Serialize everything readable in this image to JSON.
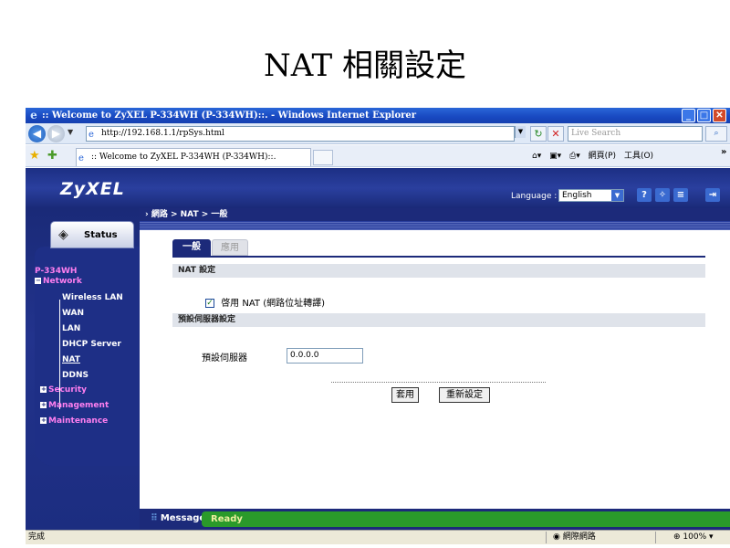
{
  "slide": {
    "title": "NAT 相關設定"
  },
  "window": {
    "title": ":: Welcome to ZyXEL P-334WH (P-334WH)::. - Windows Internet Explorer",
    "address": "http://192.168.1.1/rpSys.html",
    "search_placeholder": "Live Search",
    "tab_title": ":: Welcome to ZyXEL P-334WH (P-334WH)::.",
    "toolbar_page": "網頁(P)",
    "toolbar_tools": "工具(O)"
  },
  "router": {
    "logo": "ZyXEL",
    "language_label": "Language :",
    "language_value": "English",
    "breadcrumb": "› 網路 > NAT > 一般",
    "status_label": "Status",
    "nav": {
      "device": "P-334WH",
      "network": "Network",
      "items": [
        "Wireless LAN",
        "WAN",
        "LAN",
        "DHCP Server",
        "NAT",
        "DDNS"
      ],
      "security": "Security",
      "management": "Management",
      "maintenance": "Maintenance"
    },
    "tabs": [
      "一般",
      "應用"
    ],
    "section_nat": "NAT 設定",
    "enable_nat": "啓用 NAT (網路位址轉譯)",
    "section_default_server": "預設伺服器設定",
    "default_server_label": "預設伺服器",
    "default_server_value": "0.0.0.0",
    "apply_button": "套用",
    "reset_button": "重新設定",
    "message_label": "Message",
    "message_value": "Ready"
  },
  "statusbar": {
    "done": "完成",
    "zone": "網際網路",
    "zoom": "100%"
  }
}
